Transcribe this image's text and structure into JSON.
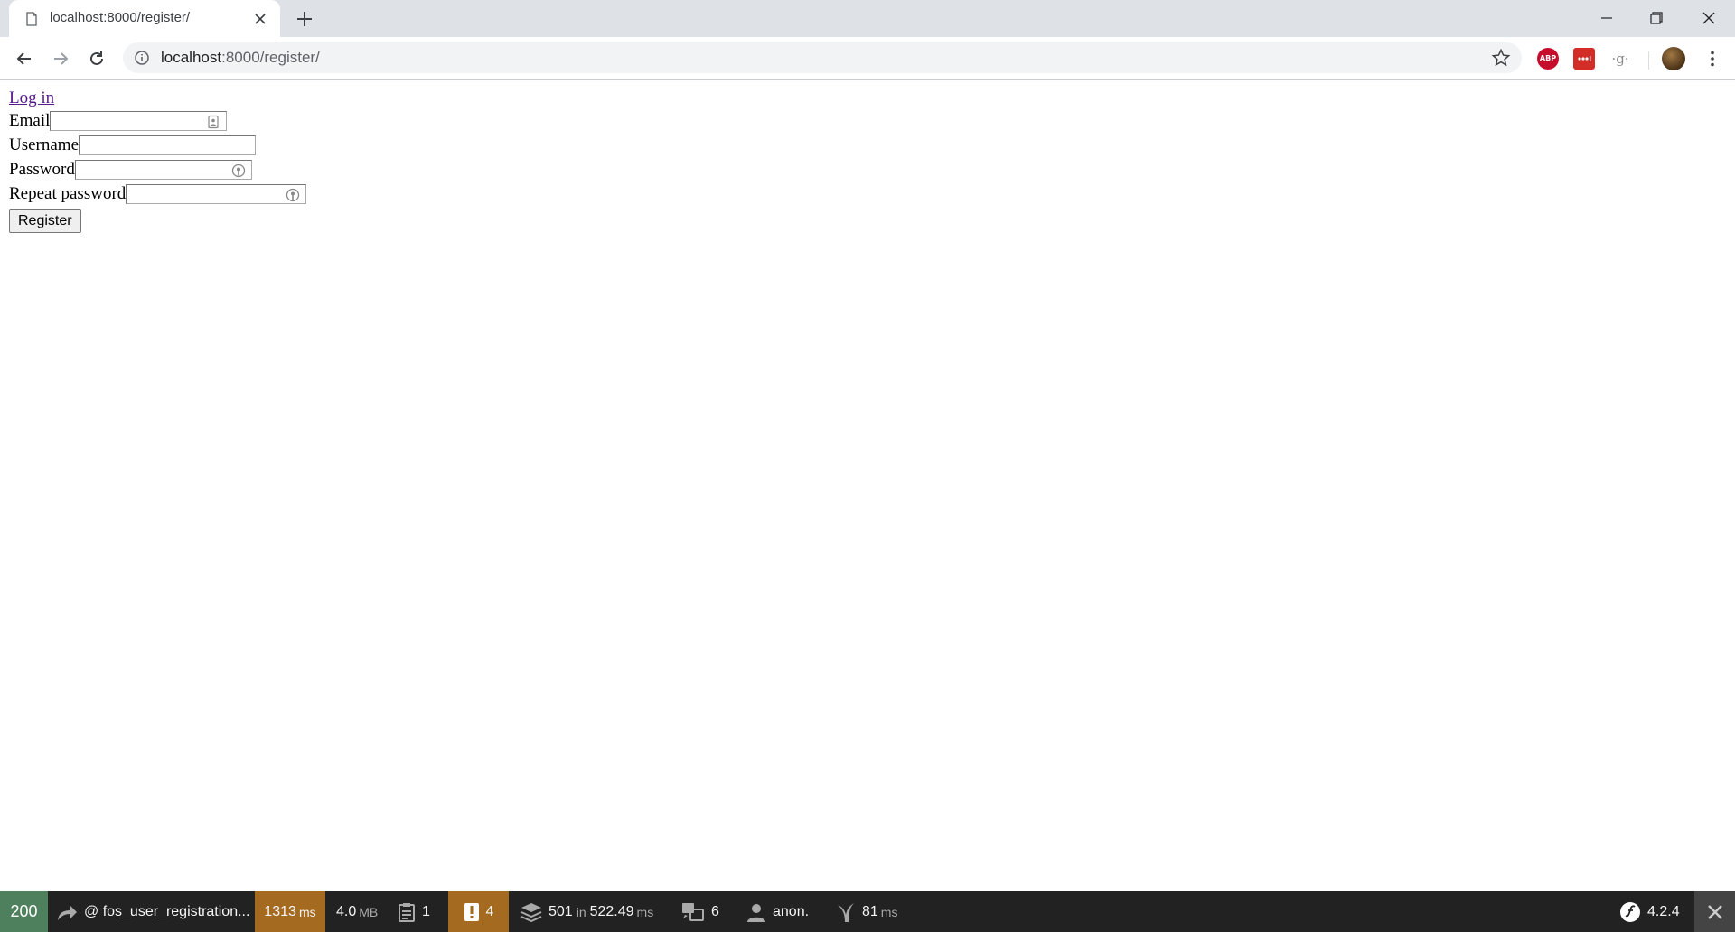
{
  "browser": {
    "tab_title": "localhost:8000/register/",
    "url_host": "localhost",
    "url_rest": ":8000/register/",
    "extensions": {
      "abp": "ABP",
      "grammar": "·g·"
    }
  },
  "page": {
    "login_link": "Log in",
    "form": {
      "email_label": "Email",
      "username_label": "Username",
      "password_label": "Password",
      "repeat_password_label": "Repeat password",
      "email_value": "",
      "username_value": "",
      "password_value": "",
      "repeat_password_value": "",
      "submit_label": "Register"
    }
  },
  "debug_toolbar": {
    "status": "200",
    "route": "@ fos_user_registration...",
    "time_value": "1313",
    "time_unit": "ms",
    "memory_value": "4.0",
    "memory_unit": "MB",
    "logs_count": "1",
    "warnings_count": "4",
    "db_queries": "501",
    "db_in": "in",
    "db_time": "522.49",
    "db_unit": "ms",
    "translations": "6",
    "user": "anon.",
    "twig_time": "81",
    "twig_unit": "ms",
    "version": "4.2.4",
    "colors": {
      "status_ok": "#4f805d",
      "warning": "#a46a1f",
      "background": "#222222"
    }
  }
}
